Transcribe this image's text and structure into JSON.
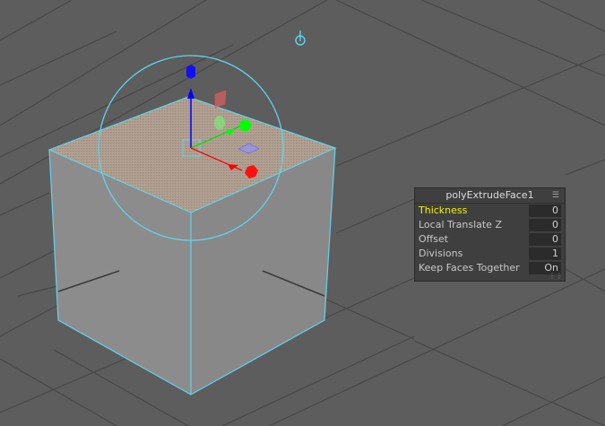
{
  "hud": {
    "title": "polyExtrudeFace1",
    "rows": [
      {
        "label": "Thickness",
        "value": "0"
      },
      {
        "label": "Local Translate Z",
        "value": "0"
      },
      {
        "label": "Offset",
        "value": "0"
      },
      {
        "label": "Divisions",
        "value": "1"
      },
      {
        "label": "Keep Faces Together",
        "value": "On"
      }
    ]
  },
  "colors": {
    "background": "#5d5d5d",
    "grid": "#474747",
    "cube_side": "#8f8f8f",
    "cube_top": "#a89a8e",
    "wireframe": "#5fd3ee",
    "axis_x": "#ff0000",
    "axis_y": "#00e000",
    "axis_z": "#0000ff",
    "active_label": "#f0f000"
  },
  "icons": [
    "pivot-icon",
    "menu-icon",
    "resize-grip-icon"
  ]
}
